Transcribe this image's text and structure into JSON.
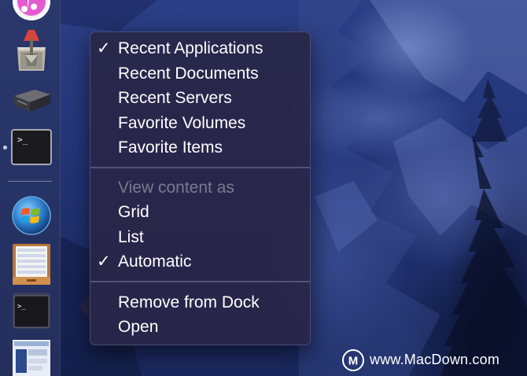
{
  "dock": {
    "items": [
      {
        "name": "iTunes",
        "icon": "itunes-icon",
        "running": false
      },
      {
        "name": "Archive Utility",
        "icon": "archive-utility-icon",
        "running": false
      },
      {
        "name": "External Drive",
        "icon": "drive-icon",
        "running": false
      },
      {
        "name": "Terminal",
        "icon": "terminal-icon",
        "running": true
      },
      {
        "name": "Boot Camp",
        "icon": "windows-icon",
        "running": false
      },
      {
        "name": "Stacks Folder",
        "icon": "stack-folder-icon",
        "running": false
      },
      {
        "name": "Terminal Stack",
        "icon": "terminal-stack-icon",
        "running": false
      },
      {
        "name": "Screenshot",
        "icon": "screenshot-thumb-icon",
        "running": false
      }
    ],
    "terminal_prompt": ">_"
  },
  "context_menu": {
    "section_display": [
      {
        "label": "Recent Applications",
        "checked": true
      },
      {
        "label": "Recent Documents",
        "checked": false
      },
      {
        "label": "Recent Servers",
        "checked": false
      },
      {
        "label": "Favorite Volumes",
        "checked": false
      },
      {
        "label": "Favorite Items",
        "checked": false
      }
    ],
    "view_header": "View content as",
    "section_view": [
      {
        "label": "Grid",
        "checked": false
      },
      {
        "label": "List",
        "checked": false
      },
      {
        "label": "Automatic",
        "checked": true
      }
    ],
    "section_actions": [
      {
        "label": "Remove from Dock"
      },
      {
        "label": "Open"
      }
    ],
    "check_glyph": "✓"
  },
  "watermark": {
    "text": "www.MacDown.com",
    "logo_letter": "M"
  },
  "colors": {
    "menu_bg": "#282648",
    "menu_text": "#ffffff",
    "disabled_text": "#8a88a8",
    "wallpaper": "#24367a"
  }
}
